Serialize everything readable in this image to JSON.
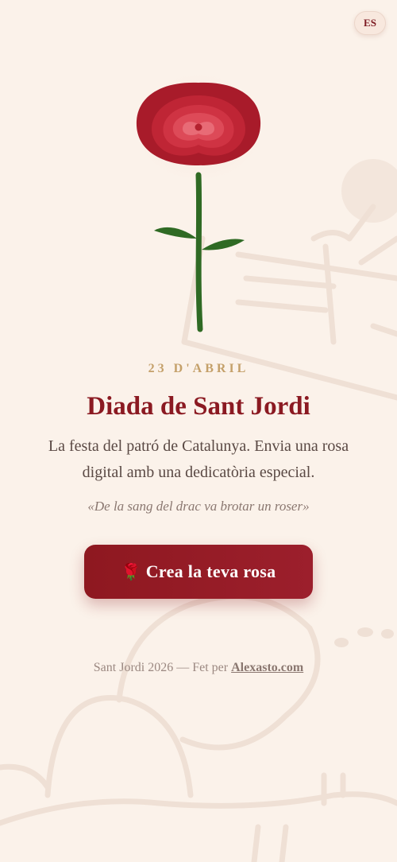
{
  "language_toggle": {
    "label": "ES"
  },
  "hero": {
    "date": "23 D'ABRIL",
    "title": "Diada de Sant Jordi",
    "description": "La festa del patró de Catalunya. Envia una rosa digital amb una dedicatòria especial.",
    "quote": "«De la sang del drac va brotar un roser»"
  },
  "cta": {
    "icon": "🌹",
    "label": "Crea la teva rosa"
  },
  "footer": {
    "text": "Sant Jordi 2026 — Fet per ",
    "link_label": "Alexasto.com"
  },
  "colors": {
    "background": "#fbf2ea",
    "accent": "#8b1a22",
    "gold": "#c4a06a",
    "stem": "#2f6a24",
    "text": "#5a4944"
  },
  "icons": [
    "rose-icon",
    "rose-emoji-icon",
    "dragon-illustration"
  ]
}
